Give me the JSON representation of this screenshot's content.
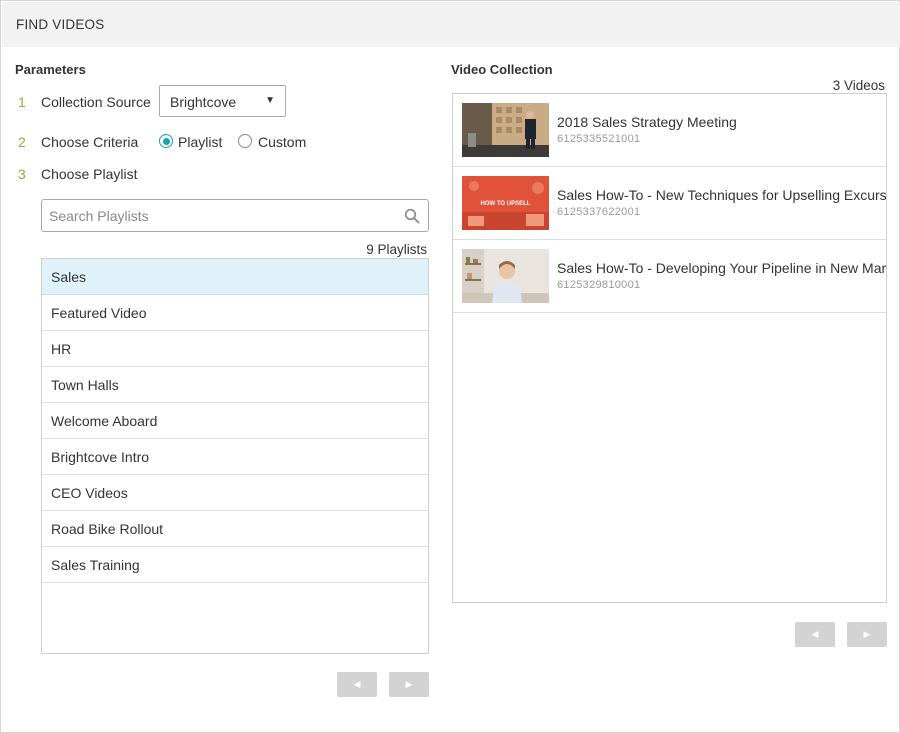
{
  "header": {
    "title": "FIND VIDEOS"
  },
  "parameters": {
    "title": "Parameters",
    "steps": [
      {
        "number": "1",
        "label": "Collection Source"
      },
      {
        "number": "2",
        "label": "Choose Criteria"
      },
      {
        "number": "3",
        "label": "Choose Playlist"
      }
    ],
    "collection_source": {
      "value": "Brightcove",
      "arrow": "▼"
    },
    "criteria": {
      "options": [
        {
          "label": "Playlist",
          "checked": true
        },
        {
          "label": "Custom",
          "checked": false
        }
      ]
    },
    "search": {
      "placeholder": "Search Playlists",
      "value": ""
    },
    "playlist_count": "9 Playlists",
    "playlists": [
      {
        "label": "Sales",
        "selected": true
      },
      {
        "label": "Featured Video",
        "selected": false
      },
      {
        "label": "HR",
        "selected": false
      },
      {
        "label": "Town Halls",
        "selected": false
      },
      {
        "label": "Welcome Aboard",
        "selected": false
      },
      {
        "label": "Brightcove Intro",
        "selected": false
      },
      {
        "label": "CEO Videos",
        "selected": false
      },
      {
        "label": "Road Bike Rollout",
        "selected": false
      },
      {
        "label": "Sales Training",
        "selected": false
      }
    ],
    "pager": {
      "prev": "◀",
      "next": "▶"
    }
  },
  "video_collection": {
    "title": "Video Collection",
    "count": "3 Videos",
    "videos": [
      {
        "title": "2018 Sales Strategy Meeting",
        "id": "6125335521001",
        "thumbnail": "presenter-on-stage"
      },
      {
        "title": "Sales How-To - New Techniques for Upselling Excursions",
        "id": "6125337622001",
        "thumbnail": "how-to-upsell-banner",
        "thumbnail_text": "HOW TO UPSELL"
      },
      {
        "title": "Sales How-To - Developing Your Pipeline in New Markets",
        "id": "6125329810001",
        "thumbnail": "person-at-desk"
      }
    ],
    "pager": {
      "prev": "◀",
      "next": "▶"
    }
  },
  "colors": {
    "step_number": "#8bb530",
    "radio_accent": "#1aa0b8",
    "selected_row": "#dff2fa",
    "header_bg": "#f2f2f2",
    "pager_button": "#d3d3d3"
  }
}
